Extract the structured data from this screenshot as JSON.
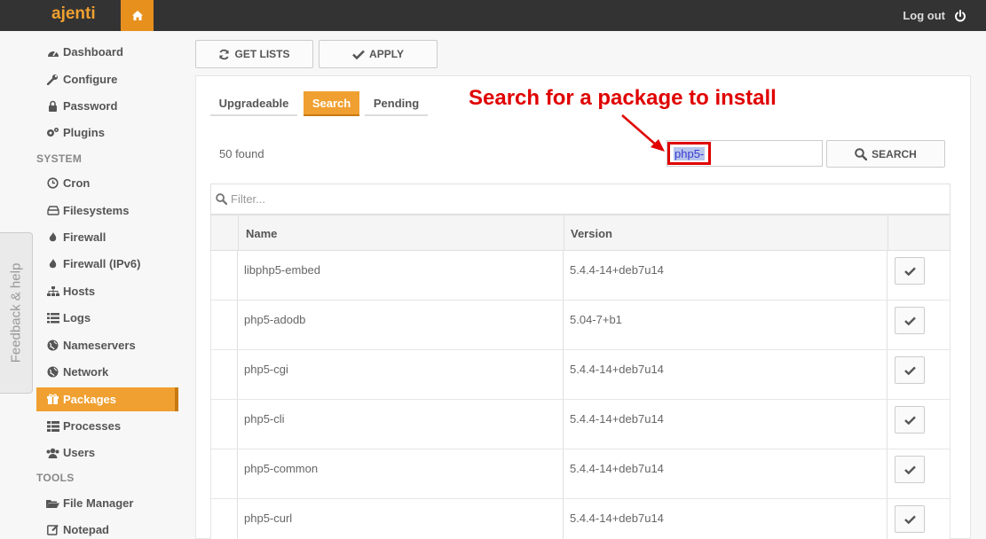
{
  "app": {
    "brand": "ajenti",
    "logout_label": "Log out"
  },
  "sidebar": {
    "items": [
      {
        "label": "Dashboard",
        "icon": "dashboard-icon"
      },
      {
        "label": "Configure",
        "icon": "wrench-icon"
      },
      {
        "label": "Password",
        "icon": "lock-icon"
      },
      {
        "label": "Plugins",
        "icon": "cogs-icon"
      }
    ],
    "section_system": "SYSTEM",
    "system_items": [
      {
        "label": "Cron",
        "icon": "clock-icon"
      },
      {
        "label": "Filesystems",
        "icon": "hdd-icon"
      },
      {
        "label": "Firewall",
        "icon": "fire-icon"
      },
      {
        "label": "Firewall (IPv6)",
        "icon": "fire-icon"
      },
      {
        "label": "Hosts",
        "icon": "sitemap-icon"
      },
      {
        "label": "Logs",
        "icon": "list-icon"
      },
      {
        "label": "Nameservers",
        "icon": "globe-icon"
      },
      {
        "label": "Network",
        "icon": "globe-icon"
      },
      {
        "label": "Packages",
        "icon": "gift-icon"
      },
      {
        "label": "Processes",
        "icon": "th-list-icon"
      },
      {
        "label": "Users",
        "icon": "users-icon"
      }
    ],
    "section_tools": "TOOLS",
    "tools_items": [
      {
        "label": "File Manager",
        "icon": "folder-open-icon"
      },
      {
        "label": "Notepad",
        "icon": "edit-icon"
      }
    ]
  },
  "feedback_label": "Feedback & help",
  "toolbar": {
    "get_lists": "GET LISTS",
    "apply": "APPLY"
  },
  "tabs": [
    "Upgradeable",
    "Search",
    "Pending"
  ],
  "active_tab": "Search",
  "annotation": "Search for a package to install",
  "search": {
    "found": "50 found",
    "value": "php5-",
    "button": "SEARCH"
  },
  "filter": {
    "placeholder": "Filter..."
  },
  "table": {
    "headers": [
      "Name",
      "Version"
    ],
    "rows": [
      {
        "name": "libphp5-embed",
        "version": "5.4.4-14+deb7u14"
      },
      {
        "name": "php5-adodb",
        "version": "5.04-7+b1"
      },
      {
        "name": "php5-cgi",
        "version": "5.4.4-14+deb7u14"
      },
      {
        "name": "php5-cli",
        "version": "5.4.4-14+deb7u14"
      },
      {
        "name": "php5-common",
        "version": "5.4.4-14+deb7u14"
      },
      {
        "name": "php5-curl",
        "version": "5.4.4-14+deb7u14"
      }
    ]
  },
  "colors": {
    "accent": "#f0a030",
    "topbar": "#333333",
    "annotation": "#e00000"
  }
}
